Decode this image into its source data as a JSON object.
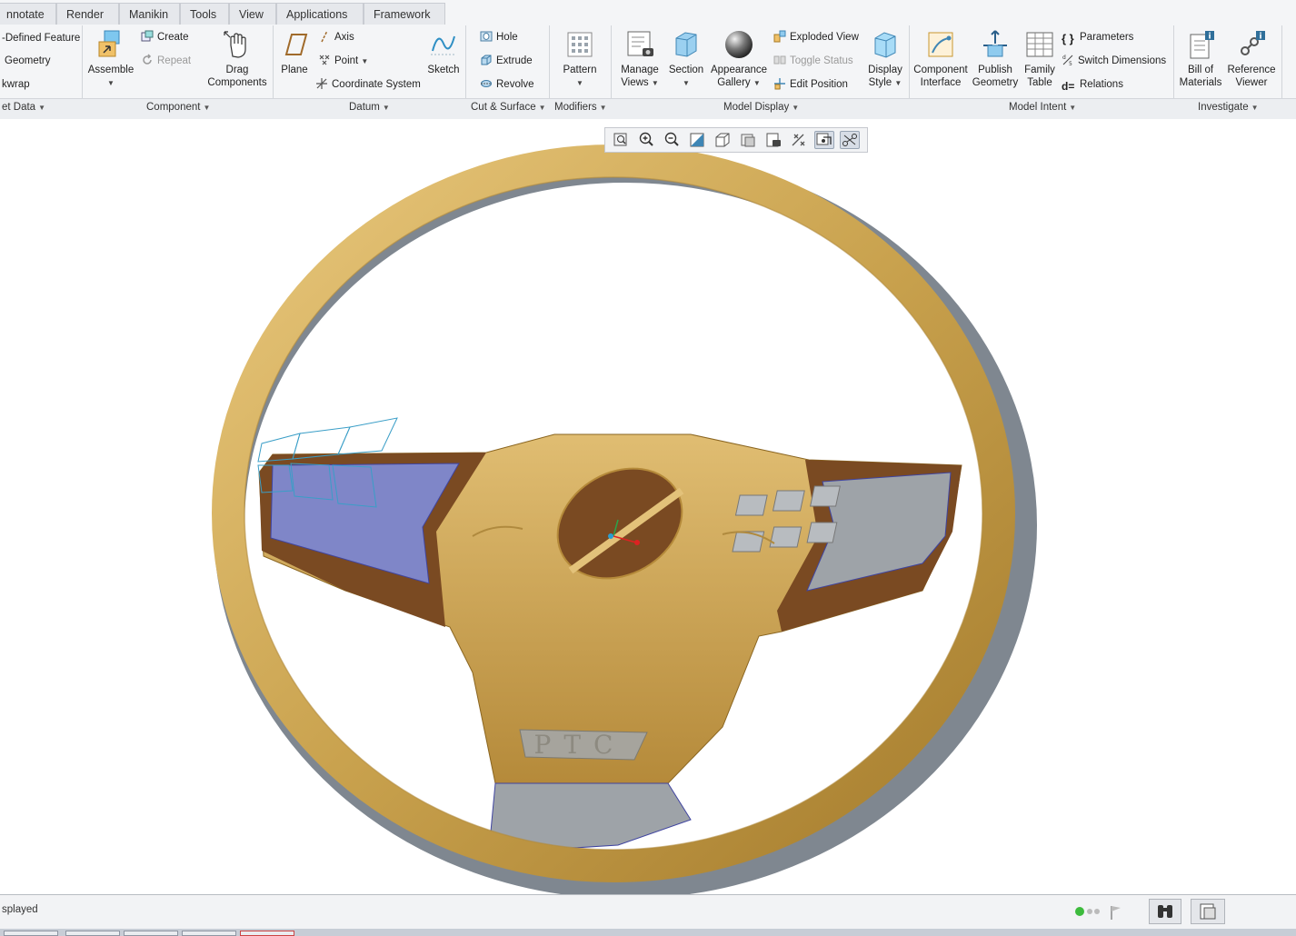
{
  "menu_tabs": [
    "nnotate",
    "Render",
    "Manikin",
    "Tools",
    "View",
    "Applications",
    "Framework"
  ],
  "ribbon": {
    "get_data": {
      "items": [
        "-Defined Feature",
        "Geometry",
        "kwrap"
      ],
      "group": "et Data"
    },
    "component": {
      "assemble": "Assemble",
      "create": "Create",
      "repeat": "Repeat",
      "drag_components": [
        "Drag",
        "Components"
      ],
      "group": "Component"
    },
    "datum": {
      "plane": "Plane",
      "axis": "Axis",
      "point": "Point",
      "coordinate_system": "Coordinate System",
      "sketch": "Sketch",
      "group": "Datum"
    },
    "cut_surface": {
      "hole": "Hole",
      "extrude": "Extrude",
      "revolve": "Revolve",
      "group": "Cut & Surface"
    },
    "modifiers": {
      "pattern": "Pattern",
      "group": "Modifiers"
    },
    "model_display": {
      "manage_views": [
        "Manage",
        "Views"
      ],
      "section": "Section",
      "appearance_gallery": [
        "Appearance",
        "Gallery"
      ],
      "exploded_view": "Exploded View",
      "toggle_status": "Toggle Status",
      "edit_position": "Edit Position",
      "display_style": [
        "Display",
        "Style"
      ],
      "group": "Model Display"
    },
    "model_intent": {
      "component_interface": [
        "Component",
        "Interface"
      ],
      "publish_geometry": [
        "Publish",
        "Geometry"
      ],
      "family_table": [
        "Family",
        "Table"
      ],
      "parameters": "Parameters",
      "switch_dimensions": "Switch Dimensions",
      "relations": "Relations",
      "group": "Model Intent"
    },
    "investigate": {
      "bill_of_materials": [
        "Bill of",
        "Materials"
      ],
      "reference_viewer": [
        "Reference",
        "Viewer"
      ],
      "group": "Investigate"
    }
  },
  "viewport": {
    "emblem_text": "PTC",
    "toolbar_icons": [
      "refit-icon",
      "zoom-in-icon",
      "zoom-out-icon",
      "repaint-icon",
      "saved-orientations-icon",
      "display-style-icon",
      "view-manager-icon",
      "datum-display-icon",
      "spin-center-icon",
      "annotation-display-icon"
    ],
    "colors": {
      "wheel_gold": "#c9a24e",
      "trim_brown": "#7a4a22",
      "panel_blue": "#7f86c8",
      "panel_gray": "#9ea3a8",
      "rim_shadow": "#7f8790"
    }
  },
  "status": {
    "text": "splayed"
  }
}
